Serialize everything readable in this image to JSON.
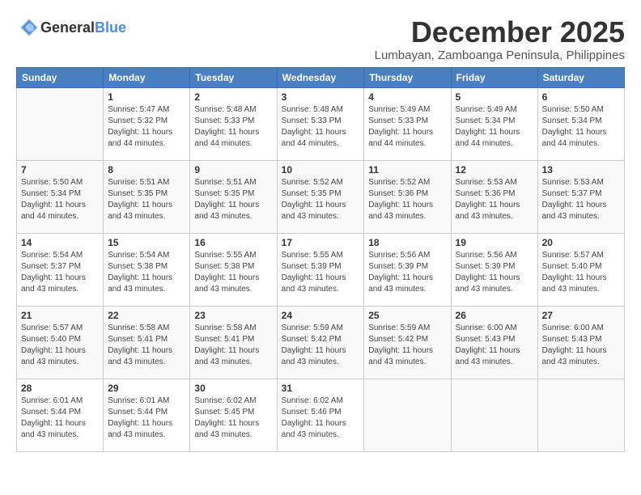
{
  "header": {
    "logo_general": "General",
    "logo_blue": "Blue",
    "month_year": "December 2025",
    "location": "Lumbayan, Zamboanga Peninsula, Philippines"
  },
  "weekdays": [
    "Sunday",
    "Monday",
    "Tuesday",
    "Wednesday",
    "Thursday",
    "Friday",
    "Saturday"
  ],
  "weeks": [
    [
      {
        "day": "",
        "info": ""
      },
      {
        "day": "1",
        "info": "Sunrise: 5:47 AM\nSunset: 5:32 PM\nDaylight: 11 hours\nand 44 minutes."
      },
      {
        "day": "2",
        "info": "Sunrise: 5:48 AM\nSunset: 5:33 PM\nDaylight: 11 hours\nand 44 minutes."
      },
      {
        "day": "3",
        "info": "Sunrise: 5:48 AM\nSunset: 5:33 PM\nDaylight: 11 hours\nand 44 minutes."
      },
      {
        "day": "4",
        "info": "Sunrise: 5:49 AM\nSunset: 5:33 PM\nDaylight: 11 hours\nand 44 minutes."
      },
      {
        "day": "5",
        "info": "Sunrise: 5:49 AM\nSunset: 5:34 PM\nDaylight: 11 hours\nand 44 minutes."
      },
      {
        "day": "6",
        "info": "Sunrise: 5:50 AM\nSunset: 5:34 PM\nDaylight: 11 hours\nand 44 minutes."
      }
    ],
    [
      {
        "day": "7",
        "info": "Sunrise: 5:50 AM\nSunset: 5:34 PM\nDaylight: 11 hours\nand 44 minutes."
      },
      {
        "day": "8",
        "info": "Sunrise: 5:51 AM\nSunset: 5:35 PM\nDaylight: 11 hours\nand 43 minutes."
      },
      {
        "day": "9",
        "info": "Sunrise: 5:51 AM\nSunset: 5:35 PM\nDaylight: 11 hours\nand 43 minutes."
      },
      {
        "day": "10",
        "info": "Sunrise: 5:52 AM\nSunset: 5:35 PM\nDaylight: 11 hours\nand 43 minutes."
      },
      {
        "day": "11",
        "info": "Sunrise: 5:52 AM\nSunset: 5:36 PM\nDaylight: 11 hours\nand 43 minutes."
      },
      {
        "day": "12",
        "info": "Sunrise: 5:53 AM\nSunset: 5:36 PM\nDaylight: 11 hours\nand 43 minutes."
      },
      {
        "day": "13",
        "info": "Sunrise: 5:53 AM\nSunset: 5:37 PM\nDaylight: 11 hours\nand 43 minutes."
      }
    ],
    [
      {
        "day": "14",
        "info": "Sunrise: 5:54 AM\nSunset: 5:37 PM\nDaylight: 11 hours\nand 43 minutes."
      },
      {
        "day": "15",
        "info": "Sunrise: 5:54 AM\nSunset: 5:38 PM\nDaylight: 11 hours\nand 43 minutes."
      },
      {
        "day": "16",
        "info": "Sunrise: 5:55 AM\nSunset: 5:38 PM\nDaylight: 11 hours\nand 43 minutes."
      },
      {
        "day": "17",
        "info": "Sunrise: 5:55 AM\nSunset: 5:39 PM\nDaylight: 11 hours\nand 43 minutes."
      },
      {
        "day": "18",
        "info": "Sunrise: 5:56 AM\nSunset: 5:39 PM\nDaylight: 11 hours\nand 43 minutes."
      },
      {
        "day": "19",
        "info": "Sunrise: 5:56 AM\nSunset: 5:39 PM\nDaylight: 11 hours\nand 43 minutes."
      },
      {
        "day": "20",
        "info": "Sunrise: 5:57 AM\nSunset: 5:40 PM\nDaylight: 11 hours\nand 43 minutes."
      }
    ],
    [
      {
        "day": "21",
        "info": "Sunrise: 5:57 AM\nSunset: 5:40 PM\nDaylight: 11 hours\nand 43 minutes."
      },
      {
        "day": "22",
        "info": "Sunrise: 5:58 AM\nSunset: 5:41 PM\nDaylight: 11 hours\nand 43 minutes."
      },
      {
        "day": "23",
        "info": "Sunrise: 5:58 AM\nSunset: 5:41 PM\nDaylight: 11 hours\nand 43 minutes."
      },
      {
        "day": "24",
        "info": "Sunrise: 5:59 AM\nSunset: 5:42 PM\nDaylight: 11 hours\nand 43 minutes."
      },
      {
        "day": "25",
        "info": "Sunrise: 5:59 AM\nSunset: 5:42 PM\nDaylight: 11 hours\nand 43 minutes."
      },
      {
        "day": "26",
        "info": "Sunrise: 6:00 AM\nSunset: 5:43 PM\nDaylight: 11 hours\nand 43 minutes."
      },
      {
        "day": "27",
        "info": "Sunrise: 6:00 AM\nSunset: 5:43 PM\nDaylight: 11 hours\nand 43 minutes."
      }
    ],
    [
      {
        "day": "28",
        "info": "Sunrise: 6:01 AM\nSunset: 5:44 PM\nDaylight: 11 hours\nand 43 minutes."
      },
      {
        "day": "29",
        "info": "Sunrise: 6:01 AM\nSunset: 5:44 PM\nDaylight: 11 hours\nand 43 minutes."
      },
      {
        "day": "30",
        "info": "Sunrise: 6:02 AM\nSunset: 5:45 PM\nDaylight: 11 hours\nand 43 minutes."
      },
      {
        "day": "31",
        "info": "Sunrise: 6:02 AM\nSunset: 5:46 PM\nDaylight: 11 hours\nand 43 minutes."
      },
      {
        "day": "",
        "info": ""
      },
      {
        "day": "",
        "info": ""
      },
      {
        "day": "",
        "info": ""
      }
    ]
  ]
}
